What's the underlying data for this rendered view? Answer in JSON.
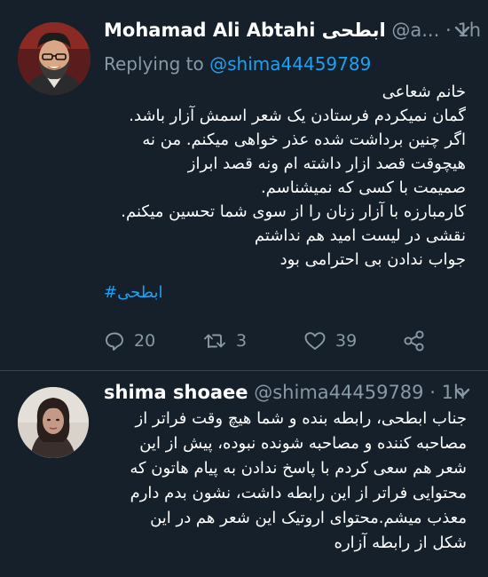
{
  "tweet1": {
    "author_name": "Mohamad Ali Abtahi ابطحی",
    "handle": "@a...",
    "dot": "·",
    "time": "1h",
    "replying_prefix": "Replying to",
    "replying_mention": "@shima44459789",
    "lines": [
      "خانم شعاعی",
      "گمان نمیکردم فرستادن یک شعر اسمش  آزار باشد.",
      "اگر چنین برداشت شده عذر خواهی میکنم. من نه",
      "هیچوقت قصد ازار داشته ام ونه قصد ابراز",
      "صمیمت با کسی که نمیشناسم.",
      "کارمبارزه با آزار زنان را از سوی شما تحسین میکنم.",
      "نقشی در لیست امید هم نداشتم",
      "جواب ندادن بی احترامی بود"
    ],
    "hashtag": "#ابطحی",
    "reply_count": "20",
    "retweet_count": "3",
    "like_count": "39"
  },
  "tweet2": {
    "author_name": "shima shoaee",
    "handle": "@shima44459789",
    "dot": "·",
    "time": "1h",
    "lines": [
      "جناب ابطحی، رابطه بنده و شما هیچ وقت فراتر از",
      "مصاحبه کننده و مصاحبه شونده نبوده، پیش از این",
      "شعر هم سعی کردم با پاسخ ندادن به پیام هاتون که",
      "محتوایی فراتر از این رابطه داشت، نشون بدم دارم",
      "معذب میشم.محتوای اروتیک این شعر هم در این",
      "شکل از رابطه آزاره"
    ]
  },
  "colors": {
    "background": "#15202b",
    "secondary_text": "#8899a6",
    "link": "#1da1f2",
    "divider": "#38444d"
  },
  "icons": [
    "chevron-down-icon",
    "reply-icon",
    "retweet-icon",
    "like-icon",
    "share-icon"
  ]
}
